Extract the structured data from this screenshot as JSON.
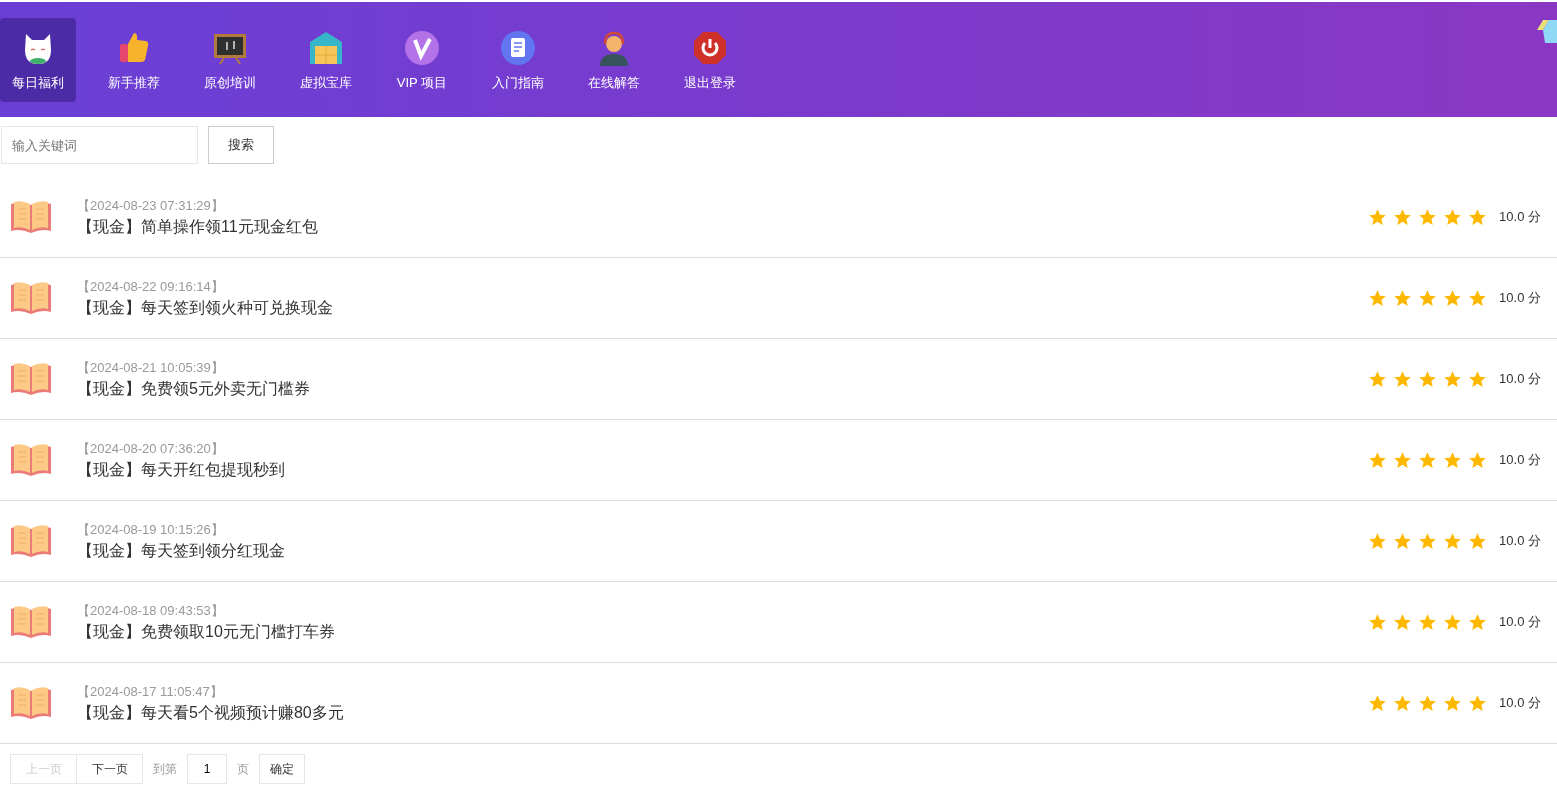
{
  "nav": {
    "items": [
      {
        "label": "每日福利",
        "selected": true
      },
      {
        "label": "新手推荐",
        "selected": false
      },
      {
        "label": "原创培训",
        "selected": false
      },
      {
        "label": "虚拟宝库",
        "selected": false
      },
      {
        "label": "VIP 项目",
        "selected": false
      },
      {
        "label": "入门指南",
        "selected": false
      },
      {
        "label": "在线解答",
        "selected": false
      },
      {
        "label": "退出登录",
        "selected": false
      }
    ]
  },
  "search": {
    "placeholder": "输入关键词",
    "button": "搜索"
  },
  "articles": [
    {
      "date": "【2024-08-23 07:31:29】",
      "title": "【现金】简单操作领11元现金红包",
      "stars": 5,
      "score": "10.0 分"
    },
    {
      "date": "【2024-08-22 09:16:14】",
      "title": "【现金】每天签到领火种可兑换现金",
      "stars": 5,
      "score": "10.0 分"
    },
    {
      "date": "【2024-08-21 10:05:39】",
      "title": "【现金】免费领5元外卖无门槛券",
      "stars": 5,
      "score": "10.0 分"
    },
    {
      "date": "【2024-08-20 07:36:20】",
      "title": "【现金】每天开红包提现秒到",
      "stars": 5,
      "score": "10.0 分"
    },
    {
      "date": "【2024-08-19 10:15:26】",
      "title": "【现金】每天签到领分红现金",
      "stars": 5,
      "score": "10.0 分"
    },
    {
      "date": "【2024-08-18 09:43:53】",
      "title": "【现金】免费领取10元无门槛打车券",
      "stars": 5,
      "score": "10.0 分"
    },
    {
      "date": "【2024-08-17 11:05:47】",
      "title": "【现金】每天看5个视频预计赚80多元",
      "stars": 5,
      "score": "10.0 分"
    }
  ],
  "pager": {
    "prev": {
      "label": "上一页",
      "disabled": true
    },
    "next": {
      "label": "下一页",
      "disabled": false
    },
    "goto_label": "到第",
    "page_value": "1",
    "page_unit": "页",
    "confirm": "确定"
  }
}
